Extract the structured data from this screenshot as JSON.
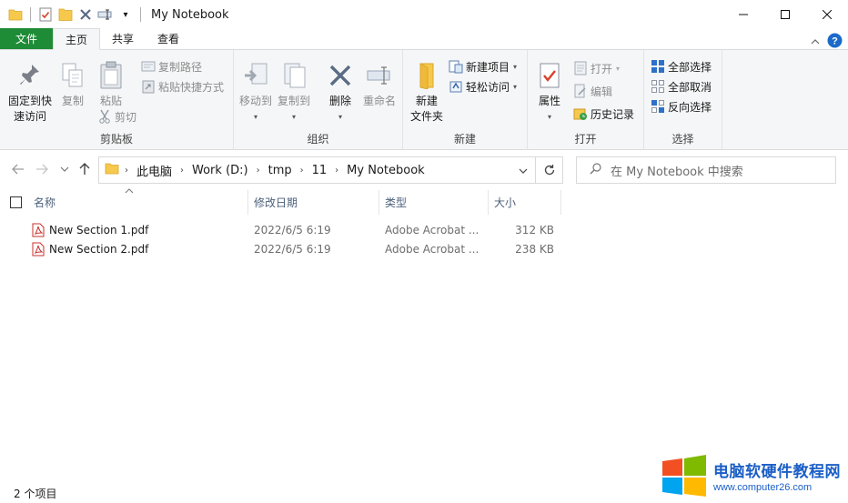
{
  "window": {
    "title": "My Notebook",
    "qat_dropdown": "▾",
    "minimize": "–",
    "maximize": "□",
    "close": "✕"
  },
  "tabs": [
    {
      "label": "文件"
    },
    {
      "label": "主页"
    },
    {
      "label": "共享"
    },
    {
      "label": "查看"
    }
  ],
  "ribbon": {
    "clipboard": {
      "label": "剪贴板",
      "pin_line1": "固定到快",
      "pin_line2": "速访问",
      "copy": "复制",
      "paste": "粘贴",
      "copy_path": "复制路径",
      "paste_shortcut": "粘贴快捷方式",
      "cut": "剪切"
    },
    "organize": {
      "label": "组织",
      "move_to": "移动到",
      "copy_to": "复制到",
      "delete": "删除",
      "rename": "重命名"
    },
    "new": {
      "label": "新建",
      "new_folder_line1": "新建",
      "new_folder_line2": "文件夹",
      "new_item": "新建项目",
      "easy_access": "轻松访问"
    },
    "open": {
      "label": "打开",
      "properties": "属性",
      "open": "打开",
      "edit": "编辑",
      "history": "历史记录"
    },
    "select": {
      "label": "选择",
      "select_all": "全部选择",
      "select_none": "全部取消",
      "invert": "反向选择"
    }
  },
  "address": {
    "crumbs": [
      "此电脑",
      "Work (D:)",
      "tmp",
      "11",
      "My Notebook"
    ],
    "search_placeholder": "在 My Notebook 中搜索"
  },
  "columns": {
    "name": "名称",
    "modified": "修改日期",
    "type": "类型",
    "size": "大小"
  },
  "files": [
    {
      "name": "New Section 1.pdf",
      "modified": "2022/6/5 6:19",
      "type": "Adobe Acrobat ...",
      "size": "312 KB"
    },
    {
      "name": "New Section 2.pdf",
      "modified": "2022/6/5 6:19",
      "type": "Adobe Acrobat ...",
      "size": "238 KB"
    }
  ],
  "status": {
    "count": "2 个项目"
  },
  "watermark": {
    "cn": "电脑软硬件教程网",
    "en": "www.computer26.com"
  },
  "colors": {
    "file_tab": "#1e8c36",
    "accent_blue": "#1b5fc6",
    "pdf_red": "#d32f2f",
    "folder_yellow": "#f6c94c"
  }
}
